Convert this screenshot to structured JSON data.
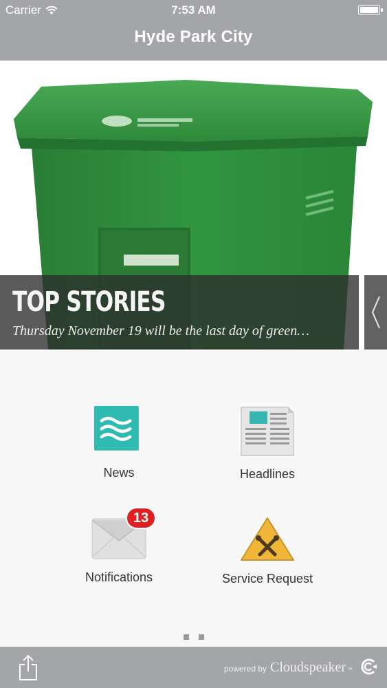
{
  "status_bar": {
    "carrier": "Carrier",
    "time": "7:53 AM"
  },
  "header": {
    "title": "Hyde Park City"
  },
  "hero": {
    "section_title": "TOP STORIES",
    "story_text": "Thursday November 19 will be the last day of green…",
    "image_icon": "green-recycling-bin-image"
  },
  "grid": [
    {
      "label": "News",
      "icon": "waves-icon",
      "color": "#2fbab2"
    },
    {
      "label": "Headlines",
      "icon": "newspaper-icon"
    },
    {
      "label": "Notifications",
      "icon": "envelope-icon",
      "badge": "13"
    },
    {
      "label": "Service Request",
      "icon": "tools-warning-icon",
      "color": "#f0b637"
    }
  ],
  "pagination": {
    "pages": 2
  },
  "bottom_bar": {
    "powered_by": "powered by",
    "brand": "Cloudspeaker",
    "trademark": "™"
  },
  "colors": {
    "bar": "#a4a5a9",
    "badge": "#e02020",
    "bin_green": "#2e8a3a"
  }
}
